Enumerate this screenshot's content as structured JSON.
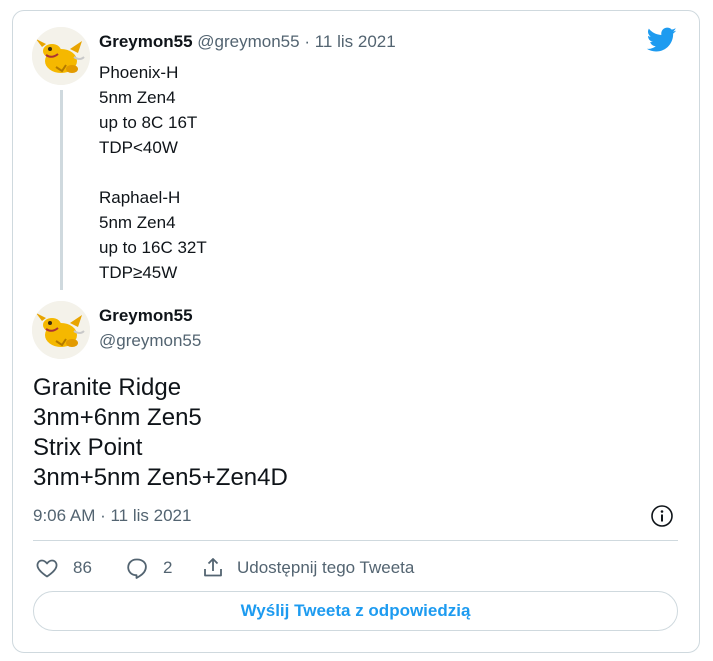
{
  "quoted_tweet": {
    "author_name": "Greymon55",
    "author_handle": "@greymon55",
    "separator": "·",
    "date": "11 lis 2021",
    "lines": [
      "Phoenix-H",
      "5nm Zen4",
      "up to 8C 16T",
      "TDP<40W",
      "",
      "Raphael-H",
      "5nm Zen4",
      "up to 16C 32T",
      "TDP≥45W"
    ]
  },
  "tweet": {
    "author_name": "Greymon55",
    "author_handle": "@greymon55",
    "lines": [
      "Granite Ridge",
      "3nm+6nm Zen5",
      "Strix Point",
      "3nm+5nm Zen5+Zen4D"
    ],
    "timestamp": "9:06 AM · 11 lis 2021"
  },
  "actions": {
    "like_count": "86",
    "reply_count": "2",
    "share_label": "Udostępnij tego Tweeta"
  },
  "reply_button_label": "Wyślij Tweeta z odpowiedzią",
  "icons": {
    "brand": "twitter-bird-icon",
    "like": "heart-icon",
    "reply": "speech-bubble-icon",
    "share": "share-icon",
    "info": "info-icon"
  },
  "colors": {
    "twitter_blue": "#1d9bf0",
    "text_primary": "#0f1419",
    "text_secondary": "#536471",
    "border": "#cfd9de"
  }
}
